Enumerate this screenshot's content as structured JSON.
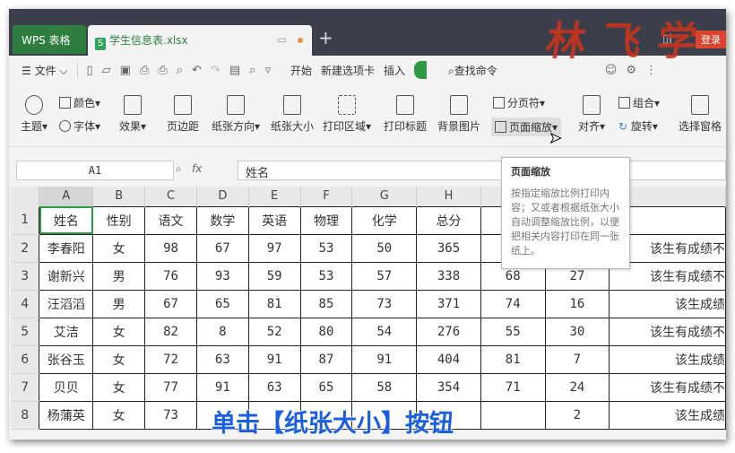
{
  "titlebar": {
    "app_tab": "WPS 表格",
    "doc_tab": "学生信息表.xlsx",
    "doc_icon": "S",
    "login": "登录",
    "new_tab": "+"
  },
  "watermark": "林飞学",
  "menu": {
    "file": "文件",
    "tabs": [
      "开始",
      "新建选项卡",
      "插入"
    ],
    "search": "查找命令"
  },
  "ribbon": {
    "theme": "主题",
    "color": "颜色",
    "font": "字体",
    "effect": "效果",
    "margin": "页边距",
    "orientation": "纸张方向",
    "paper_size": "纸张大小",
    "print_area": "打印区域",
    "print_title": "打印标题",
    "bg_image": "背景图片",
    "page_break": "分页符",
    "page_zoom": "页面缩放",
    "align": "对齐",
    "group": "组合",
    "rotate": "旋转",
    "select_pane": "选择窗格"
  },
  "formula": {
    "cell": "A1",
    "fx": "fx",
    "value": "姓名"
  },
  "tooltip": {
    "title": "页面缩放",
    "body": "按指定缩放比例打印内容；又或者根据纸张大小自动调整缩放比例，以便把相关内容打印在同一张纸上。"
  },
  "columns": [
    "A",
    "B",
    "C",
    "D",
    "E",
    "F",
    "G",
    "H"
  ],
  "rows": [
    [
      "姓名",
      "性别",
      "语文",
      "数学",
      "英语",
      "物理",
      "化学",
      "总分",
      "",
      "",
      ""
    ],
    [
      "李春阳",
      "女",
      "98",
      "67",
      "97",
      "53",
      "50",
      "365",
      "",
      "",
      "该生有成绩不"
    ],
    [
      "谢新兴",
      "男",
      "76",
      "93",
      "59",
      "53",
      "57",
      "338",
      "68",
      "27",
      "该生有成绩不"
    ],
    [
      "汪滔滔",
      "男",
      "67",
      "65",
      "81",
      "85",
      "73",
      "371",
      "74",
      "16",
      "该生成绩"
    ],
    [
      "艾洁",
      "女",
      "82",
      "8",
      "52",
      "80",
      "54",
      "276",
      "55",
      "30",
      "该生有成绩不"
    ],
    [
      "张谷玉",
      "女",
      "72",
      "63",
      "91",
      "87",
      "91",
      "404",
      "81",
      "7",
      "该生成绩"
    ],
    [
      "贝贝",
      "女",
      "77",
      "91",
      "63",
      "65",
      "58",
      "354",
      "71",
      "24",
      "该生有成绩不"
    ],
    [
      "杨蒲英",
      "女",
      "73",
      "",
      "",
      "",
      "",
      "",
      "",
      "2",
      "该生成绩"
    ]
  ],
  "caption": "单击【纸张大小】按钮"
}
